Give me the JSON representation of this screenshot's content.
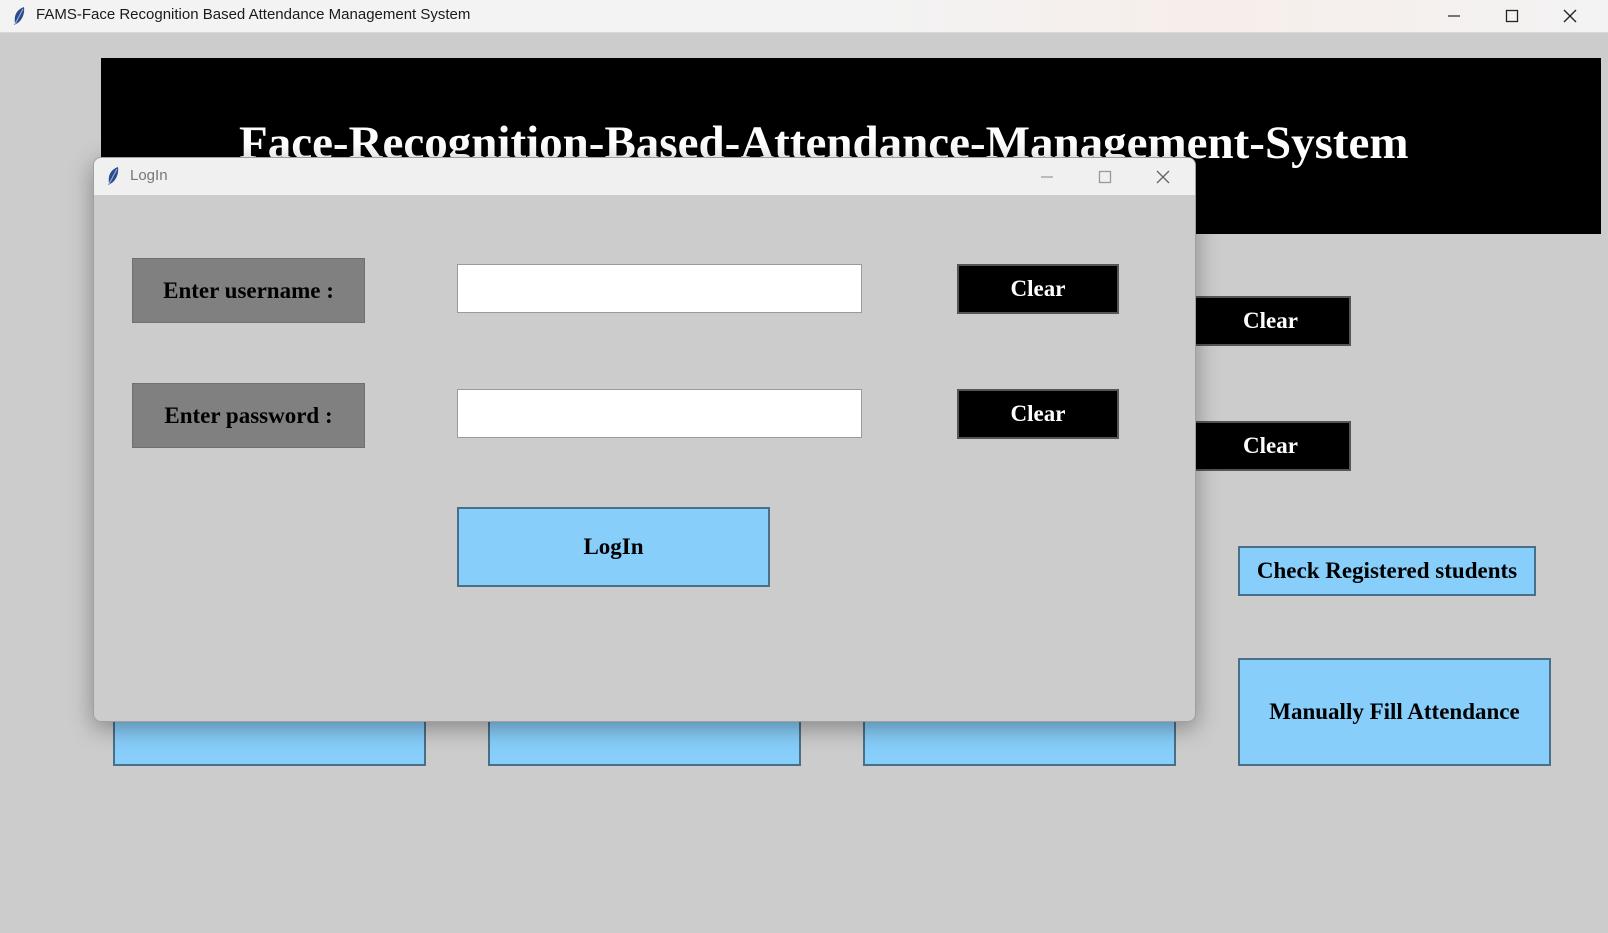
{
  "main_window": {
    "title": "FAMS-Face Recognition Based Attendance Management System",
    "banner_title": "Face-Recognition-Based-Attendance-Management-System",
    "clear_button_1": "Clear",
    "clear_button_2": "Clear",
    "check_registered_label": "Check Registered students",
    "manual_fill_label": "Manually Fill Attendance"
  },
  "login_dialog": {
    "title": "LogIn",
    "username_label": "Enter username :",
    "password_label": "Enter password :",
    "username_value": "",
    "password_value": "",
    "clear_username": "Clear",
    "clear_password": "Clear",
    "login_button": "LogIn"
  },
  "colors": {
    "background": "#cccccc",
    "banner": "#000000",
    "button_blue": "#87cefa",
    "label_gray": "#808080"
  },
  "icons": [
    "feather-icon",
    "minimize-icon",
    "maximize-icon",
    "close-icon"
  ]
}
